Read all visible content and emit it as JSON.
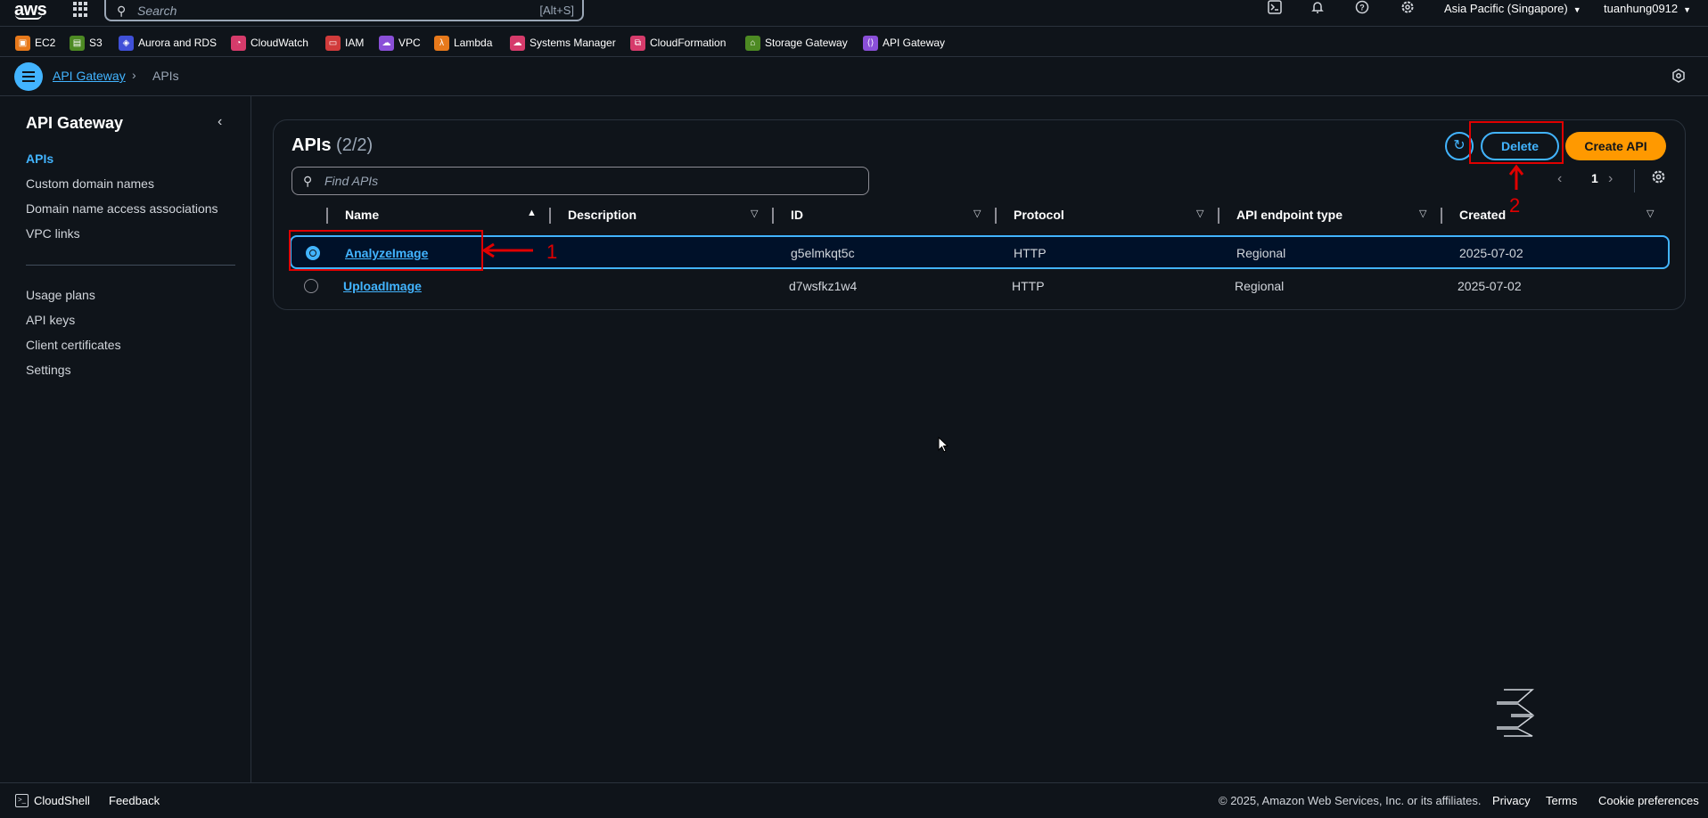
{
  "topbar": {
    "logo": "aws",
    "grid_icon": "apps-grid-icon",
    "search_placeholder": "Search",
    "search_shortcut": "[Alt+S]",
    "region": "Asia Pacific (Singapore)",
    "user": "tuanhung0912",
    "icons": [
      "cloudshell-icon",
      "bell-icon",
      "help-icon",
      "gear-icon"
    ]
  },
  "favorites": [
    {
      "label": "EC2",
      "color": "#e7791b"
    },
    {
      "label": "S3",
      "color": "#4d8a23"
    },
    {
      "label": "Aurora and RDS",
      "color": "#4050d8"
    },
    {
      "label": "CloudWatch",
      "color": "#d63b6b"
    },
    {
      "label": "IAM",
      "color": "#d13b3b"
    },
    {
      "label": "VPC",
      "color": "#8a4fd8"
    },
    {
      "label": "Lambda",
      "color": "#e7791b"
    },
    {
      "label": "Systems Manager",
      "color": "#d63b6b"
    },
    {
      "label": "CloudFormation",
      "color": "#d63b6b"
    },
    {
      "label": "Storage Gateway",
      "color": "#4d8a23"
    },
    {
      "label": "API Gateway",
      "color": "#8a4fd8"
    }
  ],
  "breadcrumb": {
    "root": "API Gateway",
    "current": "APIs"
  },
  "sidebar": {
    "title": "API Gateway",
    "items": [
      "APIs",
      "Custom domain names",
      "Domain name access associations",
      "VPC links"
    ],
    "items2": [
      "Usage plans",
      "API keys",
      "Client certificates",
      "Settings"
    ]
  },
  "panel": {
    "title": "APIs",
    "count": "(2/2)",
    "delete_label": "Delete",
    "create_label": "Create API",
    "find_placeholder": "Find APIs",
    "page": "1"
  },
  "table": {
    "columns": [
      "Name",
      "Description",
      "ID",
      "Protocol",
      "API endpoint type",
      "Created"
    ],
    "rows": [
      {
        "name": "AnalyzeImage",
        "description": "",
        "id": "g5elmkqt5c",
        "protocol": "HTTP",
        "endpoint": "Regional",
        "created": "2025-07-02",
        "selected": true
      },
      {
        "name": "UploadImage",
        "description": "",
        "id": "d7wsfkz1w4",
        "protocol": "HTTP",
        "endpoint": "Regional",
        "created": "2025-07-02",
        "selected": false
      }
    ]
  },
  "annotations": {
    "one": "1",
    "two": "2",
    "color": "#e00000"
  },
  "footer": {
    "cloudshell": "CloudShell",
    "feedback": "Feedback",
    "copyright": "© 2025, Amazon Web Services, Inc. or its affiliates.",
    "privacy": "Privacy",
    "terms": "Terms",
    "cookies": "Cookie preferences"
  }
}
